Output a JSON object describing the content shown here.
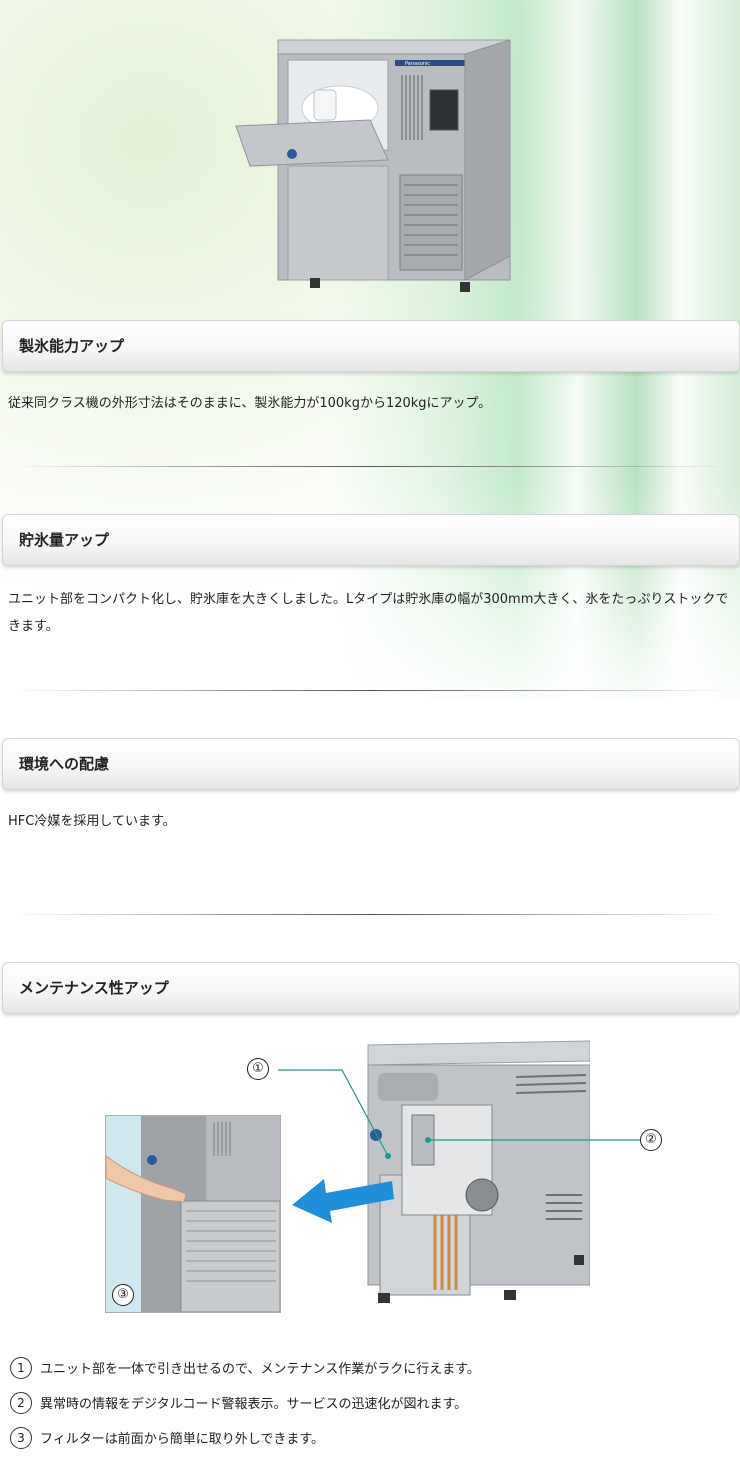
{
  "sections": [
    {
      "title": "製氷能力アップ",
      "text": "従来同クラス機の外形寸法はそのままに、製氷能力が100kgから120kgにアップ。"
    },
    {
      "title": "貯氷量アップ",
      "text": "ユニット部をコンパクト化し、貯氷庫を大きくしました。Lタイプは貯氷庫の幅が300mm大きく、氷をたっぷりストックできます。"
    },
    {
      "title": "環境への配慮",
      "text": "HFC冷媒を採用しています。"
    },
    {
      "title": "メンテナンス性アップ"
    }
  ],
  "diagram": {
    "callouts": [
      "①",
      "②",
      "③"
    ],
    "brand": "Panasonic"
  },
  "features": [
    {
      "num": "1",
      "text": "ユニット部を一体で引き出せるので、メンテナンス作業がラクに行えます。"
    },
    {
      "num": "2",
      "text": "異常時の情報をデジタルコード警報表示。サービスの迅速化が図れます。"
    },
    {
      "num": "3",
      "text": "フィルターは前面から簡単に取り外しできます。"
    }
  ],
  "colors": {
    "accent_arrow": "#1e8fd8",
    "leader_line": "#1a9a8e"
  }
}
